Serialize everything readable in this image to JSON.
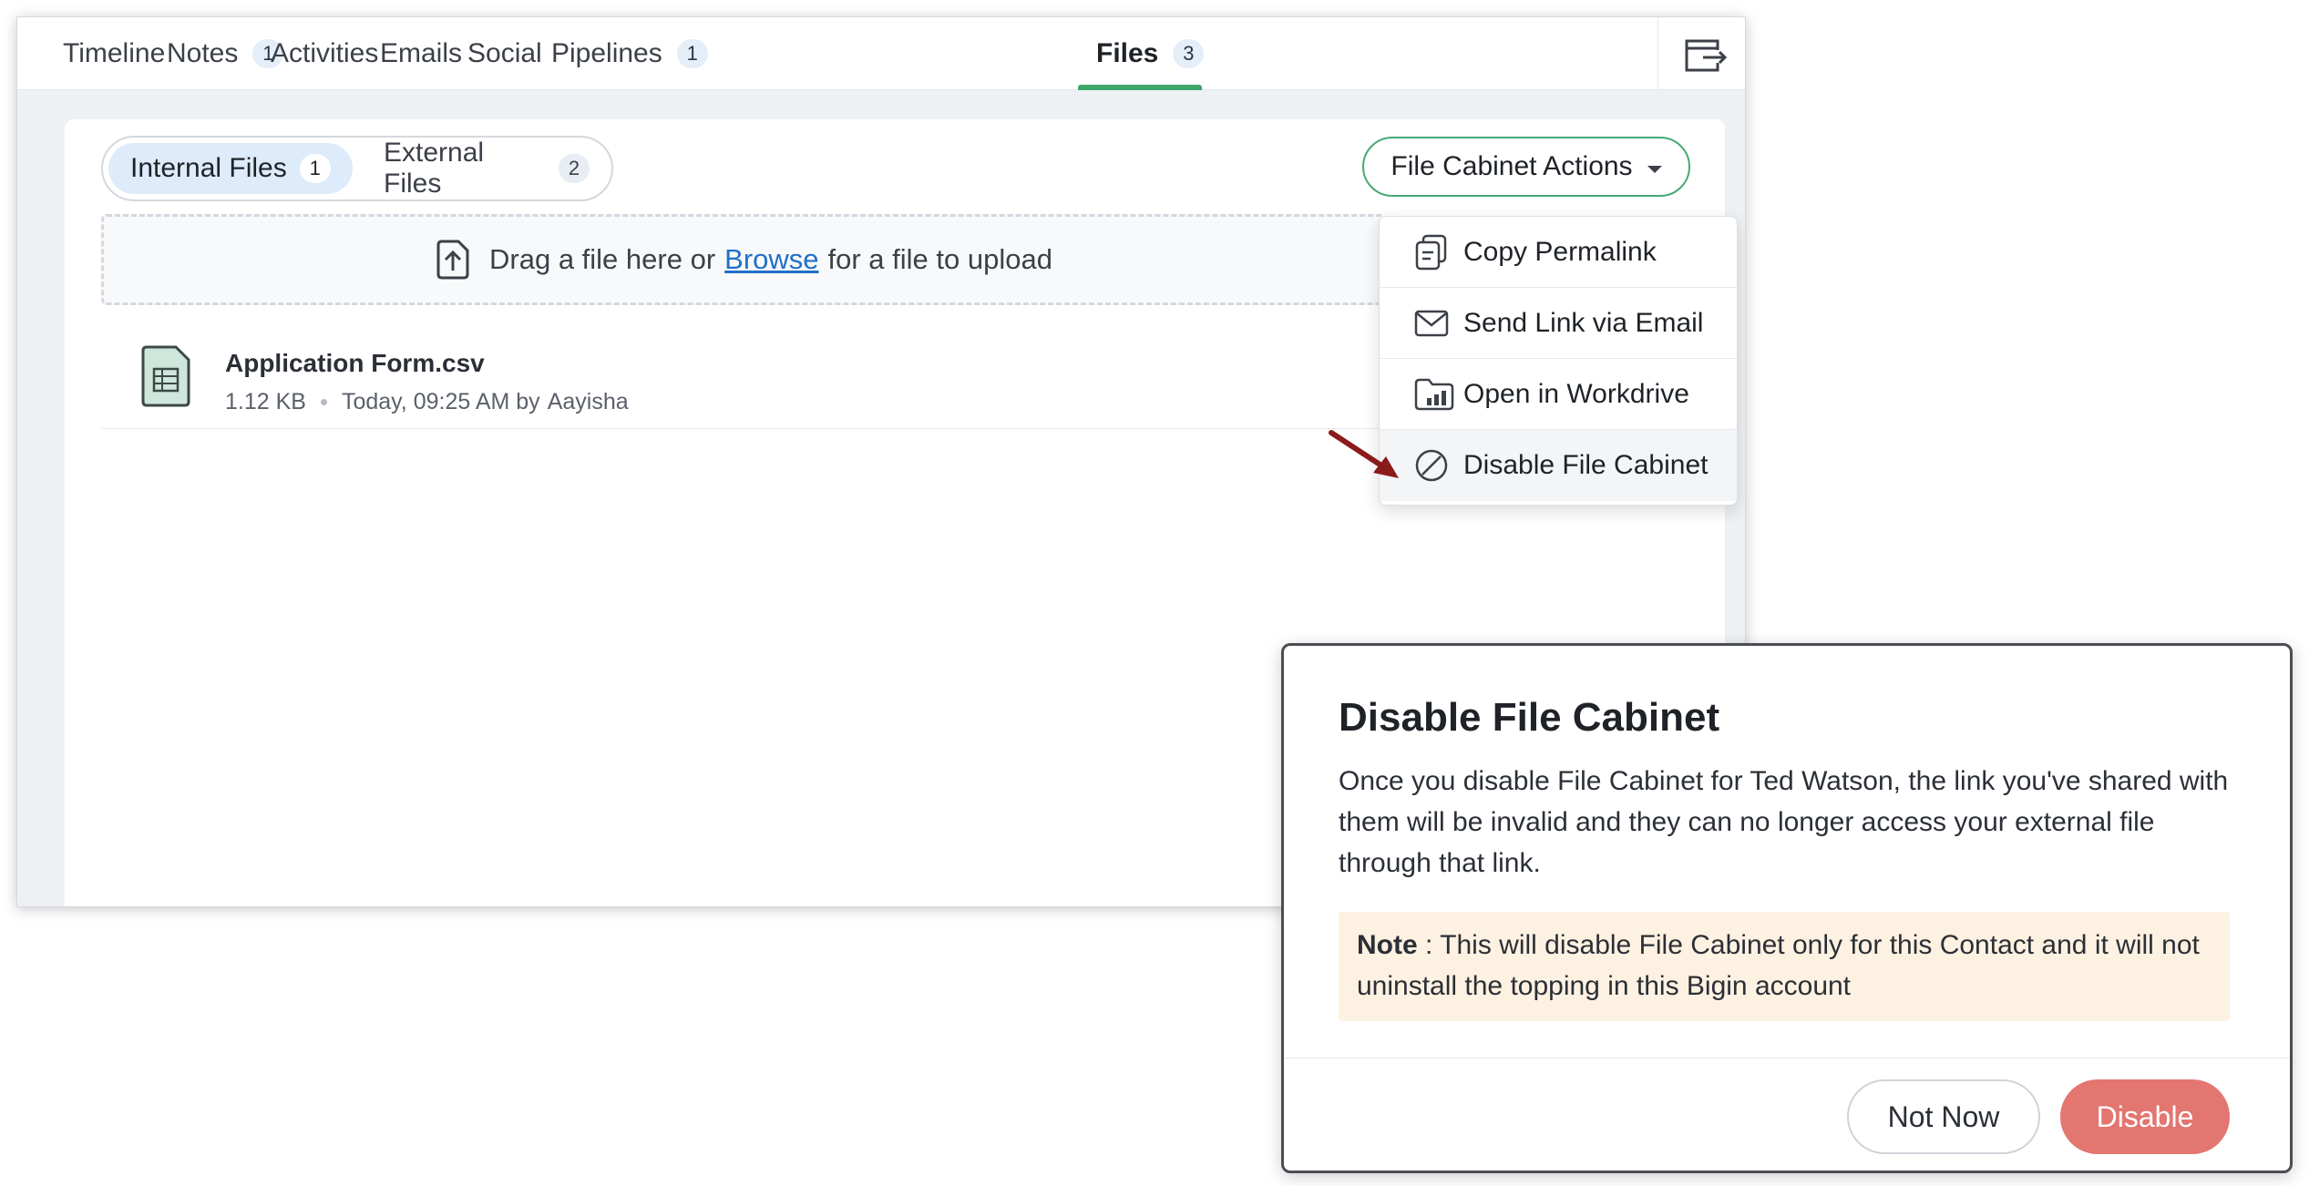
{
  "tabs": [
    {
      "label": "Timeline",
      "count": ""
    },
    {
      "label": "Notes",
      "count": "1"
    },
    {
      "label": "Activities",
      "count": ""
    },
    {
      "label": "Emails",
      "count": ""
    },
    {
      "label": "Social",
      "count": ""
    },
    {
      "label": "Pipelines",
      "count": "1"
    },
    {
      "label": "Files",
      "count": "3"
    }
  ],
  "active_tab": "Files",
  "file_tabs": {
    "internal": {
      "label": "Internal Files",
      "count": "1"
    },
    "external": {
      "label": "External Files",
      "count": "2"
    }
  },
  "actions_button": "File Cabinet Actions",
  "dropzone": {
    "prefix": "Drag a file here or",
    "link": "Browse",
    "suffix": "for a file to upload"
  },
  "files": [
    {
      "name": "Application Form.csv",
      "size": "1.12 KB",
      "time": "Today, 09:25 AM by",
      "owner": "Aayisha"
    }
  ],
  "menu": [
    {
      "label": "Copy Permalink",
      "icon": "copy-permalink-icon"
    },
    {
      "label": "Send Link via Email",
      "icon": "envelope-icon"
    },
    {
      "label": "Open in Workdrive",
      "icon": "workdrive-folder-icon"
    },
    {
      "label": "Disable File Cabinet",
      "icon": "disable-icon"
    }
  ],
  "dialog": {
    "title": "Disable File Cabinet",
    "body": "Once you disable File Cabinet for Ted Watson, the link you've shared with them will be invalid and they can no longer access your external file through that link.",
    "note_label": "Note",
    "note_sep": ":",
    "note_text": "This will disable File Cabinet only for this Contact and it will not uninstall the topping in this Bigin account",
    "cancel": "Not Now",
    "confirm": "Disable"
  },
  "colors": {
    "accent_green": "#3fa66b",
    "danger": "#e37670",
    "note_bg": "#fdf1e2",
    "link": "#2070c8",
    "arrow": "#8b1a1a"
  }
}
